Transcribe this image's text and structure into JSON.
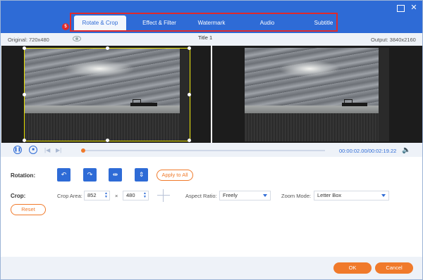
{
  "tabs": [
    "Rotate & Crop",
    "Effect & Filter",
    "Watermark",
    "Audio",
    "Subtitle"
  ],
  "active_tab": "Rotate & Crop",
  "step_badge": "5",
  "info": {
    "original": "Original: 720x480",
    "title": "Title 1",
    "output": "Output: 3840x2160"
  },
  "playback": {
    "time": "00:00:02.00/00:02:19.22",
    "progress": 0.01
  },
  "rotation": {
    "label": "Rotation:",
    "apply_all": "Apply to All",
    "buttons": [
      "rotate-left-icon",
      "rotate-right-icon",
      "flip-horizontal-icon",
      "flip-vertical-icon"
    ]
  },
  "crop": {
    "label": "Crop:",
    "area_label": "Crop Area:",
    "width": "852",
    "times": "×",
    "height": "480",
    "aspect_label": "Aspect Ratio:",
    "aspect_value": "Freely",
    "zoom_label": "Zoom Mode:",
    "zoom_value": "Letter Box",
    "reset": "Reset"
  },
  "footer": {
    "ok": "OK",
    "cancel": "Cancel"
  },
  "colors": {
    "accent": "#2e6bd6",
    "orange": "#f07a2b",
    "highlight": "#e02a2a"
  }
}
